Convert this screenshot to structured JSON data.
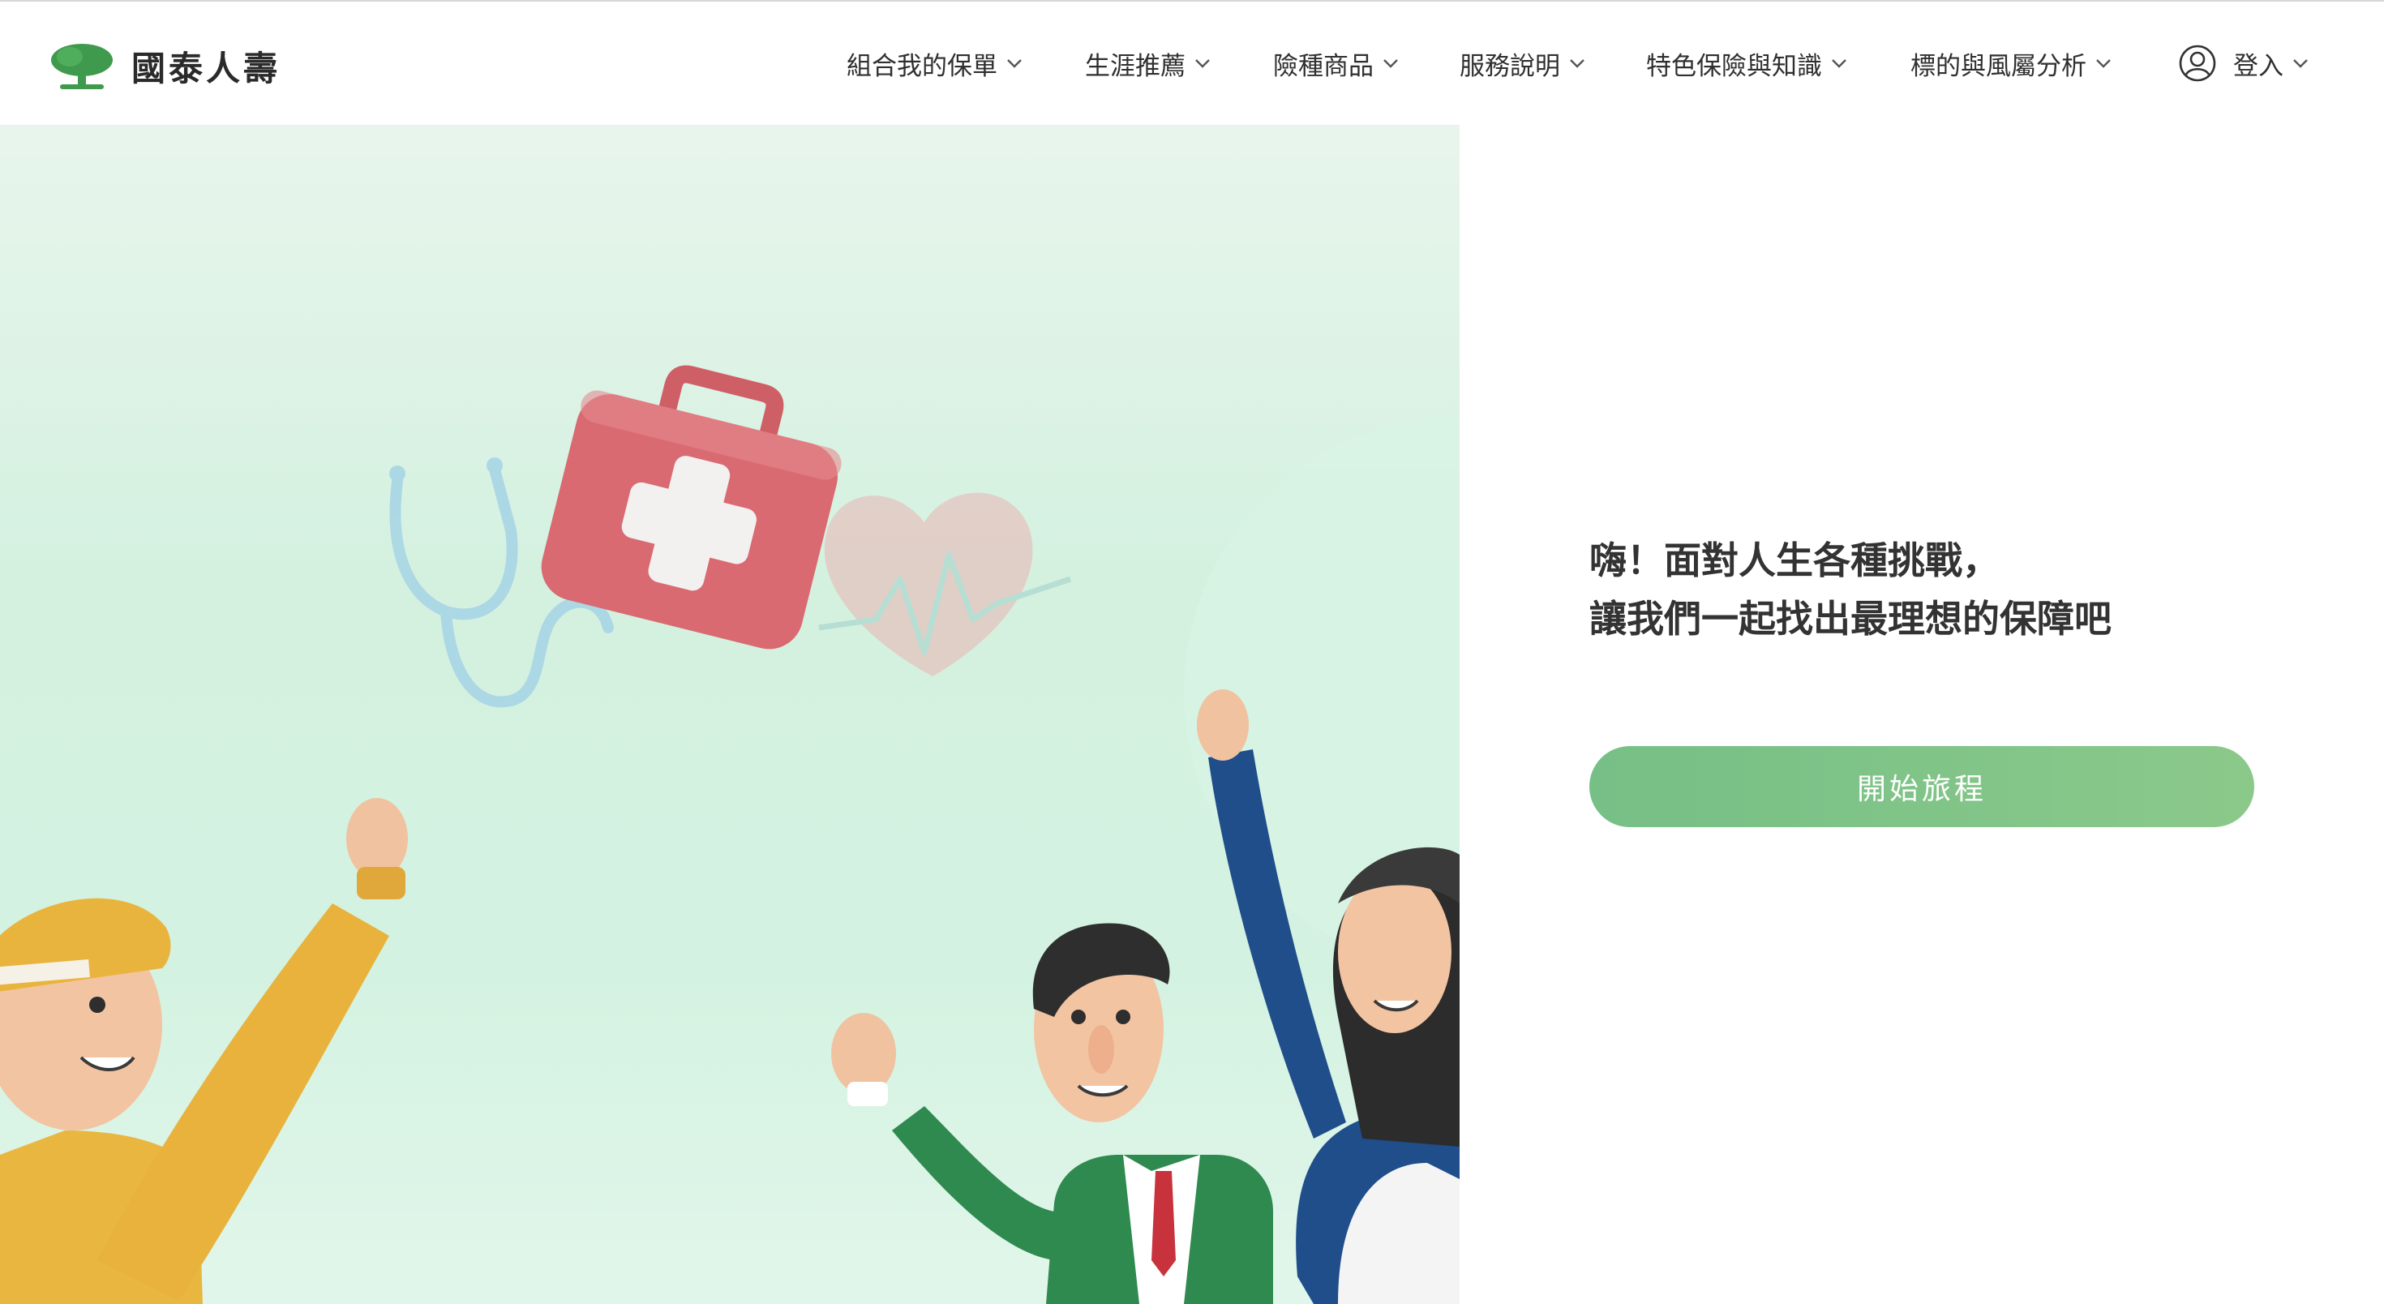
{
  "brand": {
    "name": "國泰人壽",
    "colors": {
      "tree_green": "#3f9a4d",
      "cta_green": "#7cc285",
      "hero_mint": "#d4f1e0"
    }
  },
  "nav": {
    "items": [
      {
        "label": "組合我的保單",
        "icon": "chevron-down-icon"
      },
      {
        "label": "生涯推薦",
        "icon": "chevron-down-icon"
      },
      {
        "label": "險種商品",
        "icon": "chevron-down-icon"
      },
      {
        "label": "服務說明",
        "icon": "chevron-down-icon"
      },
      {
        "label": "特色保險與知識",
        "icon": "chevron-down-icon"
      },
      {
        "label": "標的與風屬分析",
        "icon": "chevron-down-icon"
      }
    ],
    "login": {
      "label": "登入",
      "icon": "user-circle-icon"
    }
  },
  "hero": {
    "illustration": [
      "stethoscope-icon",
      "first-aid-kit-icon",
      "heart-pulse-icon",
      "man-in-cap",
      "businessman",
      "woman"
    ]
  },
  "main": {
    "headline_line1": "嗨！面對人生各種挑戰，",
    "headline_line2": "讓我們一起找出最理想的保障吧",
    "cta_label": "開始旅程"
  }
}
